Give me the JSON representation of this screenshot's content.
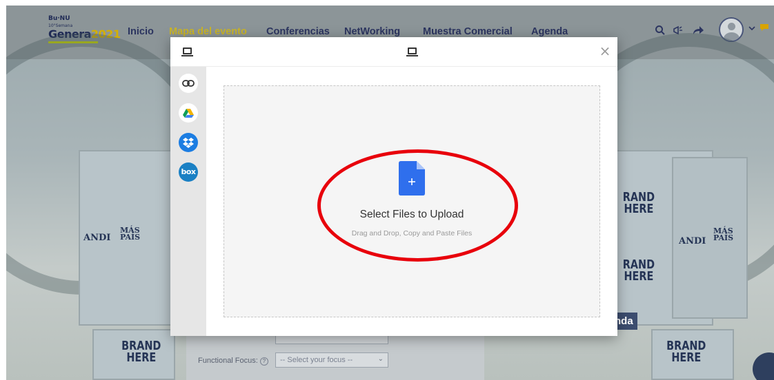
{
  "app": {
    "logo": {
      "top": "Bu·NU",
      "sub": "10°Semana",
      "main_prefix": "Genera",
      "main_suffix": "2021"
    },
    "nav": [
      {
        "label": "Inicio",
        "active": false
      },
      {
        "label": "Mapa del evento",
        "active": true
      },
      {
        "label": "Conferencias",
        "active": false
      },
      {
        "label": "NetWorking",
        "active": false
      },
      {
        "label": "Muestra Comercial",
        "active": false
      },
      {
        "label": "Agenda",
        "active": false
      }
    ],
    "icons": {
      "search": "search-icon",
      "marketing": "megaphone-icon",
      "share": "share-icon",
      "avatar": "user-avatar-icon",
      "chevron": "chevron-down-icon",
      "notification": "chat-notification-icon"
    },
    "scene": {
      "brand_left_bottom": "BRAND\nHERE",
      "brand_right_bottom": "BRAND\nHERE",
      "brand_mid_1": "RAND\nHERE",
      "brand_mid_2": "RAND\nHERE",
      "andi_left": "ANDI",
      "mas_pais_left": "MÁS\nPAÍS",
      "andi_right": "ANDI",
      "mas_pais_right": "MÁS\nPAÍS",
      "agenda_fragment": "nda"
    },
    "form": {
      "functional_focus_label": "Functional Focus:",
      "help_icon": "?",
      "select_placeholder": "-- Select your focus --"
    }
  },
  "modal": {
    "header_icon": "laptop-icon",
    "title_icon": "laptop-icon",
    "close_label": "×",
    "sources": [
      {
        "name": "link-source-button",
        "icon": "link-icon"
      },
      {
        "name": "google-drive-source-button",
        "icon": "google-drive-icon"
      },
      {
        "name": "dropbox-source-button",
        "icon": "dropbox-icon"
      },
      {
        "name": "box-source-button",
        "icon": "box-icon",
        "label": "box"
      }
    ],
    "drop_zone": {
      "icon": "file-add-icon",
      "title": "Select Files to Upload",
      "subtitle": "Drag and Drop, Copy and Paste Files"
    }
  },
  "colors": {
    "accent_blue": "#2f6fed",
    "dropbox_blue": "#1c7de2",
    "box_blue": "#1a80c4",
    "annotation_red": "#e8000b",
    "nav_active": "#c9b428"
  }
}
